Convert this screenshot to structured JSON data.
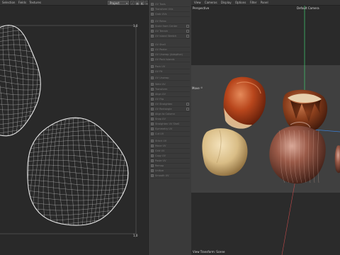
{
  "uv_editor": {
    "menu": [
      "Selection",
      "Fields",
      "Textures"
    ],
    "projection_dropdown": "Project",
    "uv_label_top": "1,0",
    "uv_label_bottom": "1,0"
  },
  "tools": {
    "items": [
      {
        "label": "UV Tools",
        "check": false
      },
      {
        "label": "Transform UVs",
        "check": false
      },
      {
        "label": "Grab UVs",
        "check": false
      },
      {
        "label": "UV Relax",
        "check": false
      },
      {
        "label": "Scale from Center",
        "check": true
      },
      {
        "label": "UV Terrain",
        "check": true
      },
      {
        "label": "UV Island Stretch",
        "check": true
      },
      {
        "label": "UV Shell",
        "check": false
      },
      {
        "label": "UV Peeler",
        "check": false
      },
      {
        "label": "UV Unwrap (Adaptive)",
        "check": false
      },
      {
        "label": "UV Pack Islands",
        "check": false
      },
      {
        "label": "Pack UV",
        "check": false
      },
      {
        "label": "UV Fit",
        "check": false
      },
      {
        "label": "UV Unwrap",
        "check": false
      },
      {
        "label": "Weld UV",
        "check": false
      },
      {
        "label": "Transform",
        "check": false
      },
      {
        "label": "Align UV",
        "check": false
      },
      {
        "label": "UV Flip",
        "check": false
      },
      {
        "label": "UV Straighten",
        "check": true
      },
      {
        "label": "UV Rectangle",
        "check": true
      },
      {
        "label": "Align to Column",
        "check": false
      },
      {
        "label": "Snap UV",
        "check": false
      },
      {
        "label": "Straighten UV Shell",
        "check": false
      },
      {
        "label": "Symmetry UV",
        "check": false
      },
      {
        "label": "Cut UV",
        "check": false
      },
      {
        "label": "Stitch UV",
        "check": false
      },
      {
        "label": "Move UV",
        "check": false
      },
      {
        "label": "Grid UV",
        "check": false
      },
      {
        "label": "Copy UV",
        "check": false
      },
      {
        "label": "Paste UV",
        "check": false
      },
      {
        "label": "Remap",
        "check": false
      },
      {
        "label": "Unitize",
        "check": false
      },
      {
        "label": "Smooth UV",
        "check": false
      }
    ]
  },
  "viewport": {
    "menu": [
      "View",
      "Cameras",
      "Display",
      "Options",
      "Filter",
      "Panel"
    ],
    "view_name": "Perspective",
    "camera_name": "Default Camera",
    "mode_label": "Move",
    "footer": "View Transform: Scene"
  },
  "colors": {
    "wireframe": "#e6e6e6",
    "axis_green": "#3fbf6a",
    "axis_blue": "#3a7fd6",
    "axis_red": "#c44a4a"
  }
}
